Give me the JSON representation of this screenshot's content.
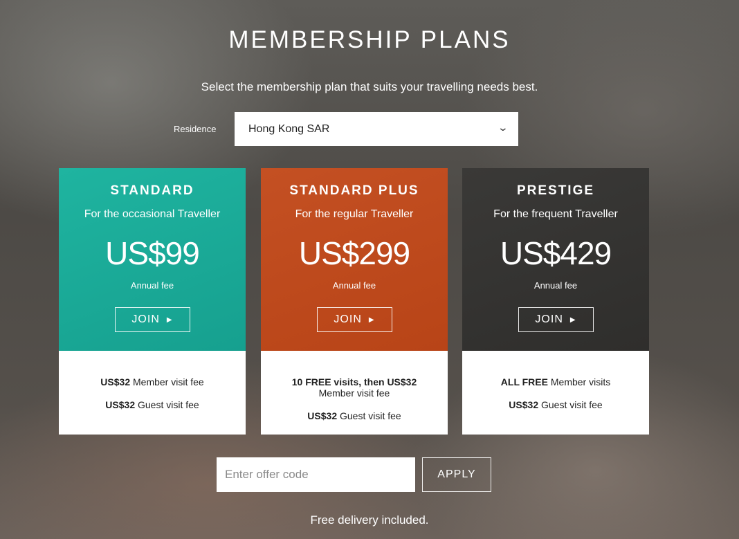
{
  "header": {
    "title": "MEMBERSHIP PLANS",
    "subtitle": "Select the membership plan that suits your travelling needs best."
  },
  "residence": {
    "label": "Residence",
    "selected": "Hong Kong SAR",
    "icon": "chevron-down-icon"
  },
  "plans": [
    {
      "name": "STANDARD",
      "tagline": "For the occasional Traveller",
      "price": "US$99",
      "fee_label": "Annual fee",
      "join_label": "JOIN",
      "color": "#1aab98",
      "member_fee_bold": "US$32",
      "member_fee_text": " Member visit fee",
      "guest_fee_bold": "US$32",
      "guest_fee_text": " Guest visit fee"
    },
    {
      "name": "STANDARD PLUS",
      "tagline": "For the regular Traveller",
      "price": "US$299",
      "fee_label": "Annual fee",
      "join_label": "JOIN",
      "color": "#bf4a1d",
      "member_fee_bold": "10 FREE visits, then US$32",
      "member_fee_text": "Member visit fee",
      "guest_fee_bold": "US$32",
      "guest_fee_text": " Guest visit fee"
    },
    {
      "name": "PRESTIGE",
      "tagline": "For the frequent Traveller",
      "price": "US$429",
      "fee_label": "Annual fee",
      "join_label": "JOIN",
      "color": "#353432",
      "member_fee_bold": "ALL FREE",
      "member_fee_text": " Member visits",
      "guest_fee_bold": "US$32",
      "guest_fee_text": " Guest visit fee"
    }
  ],
  "offer": {
    "placeholder": "Enter offer code",
    "apply_label": "APPLY"
  },
  "footer": {
    "delivery": "Free delivery included."
  }
}
